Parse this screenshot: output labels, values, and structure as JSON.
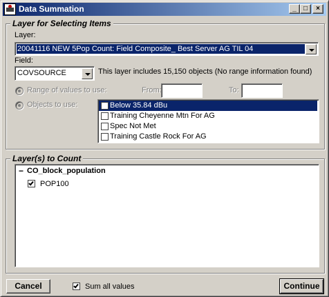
{
  "window": {
    "title": "Data Summation",
    "minimize_glyph": "_",
    "maximize_glyph": "□",
    "close_glyph": "×"
  },
  "selecting": {
    "group_label": "Layer for Selecting Items",
    "layer_label": "Layer:",
    "layer_value": "20041116 NEW 5Pop Count: Field Composite_ Best Server AG TIL 04",
    "field_label": "Field:",
    "field_value": "COVSOURCE",
    "info_text": "This layer includes 15,150 objects (No range information found)",
    "range_label": "Range of values to use:",
    "from_label": "From:",
    "to_label": "To:",
    "from_value": "",
    "to_value": "",
    "objects_label": "Objects to use:",
    "objects": [
      {
        "label": "Below 35.84 dBu",
        "checked": false,
        "selected": true
      },
      {
        "label": "Training Cheyenne Mtn For AG",
        "checked": false,
        "selected": false
      },
      {
        "label": "Spec Not Met",
        "checked": false,
        "selected": false
      },
      {
        "label": "Training Castle Rock For AG",
        "checked": false,
        "selected": false
      }
    ]
  },
  "counting": {
    "group_label": "Layer(s) to Count",
    "tree_collapse_glyph": "−",
    "layer_name": "CO_block_population",
    "fields": [
      {
        "label": "POP100",
        "checked": true
      }
    ]
  },
  "footer": {
    "cancel_label": "Cancel",
    "sum_all_label": "Sum all values",
    "sum_all_checked": true,
    "continue_label": "Continue"
  },
  "colors": {
    "title_start": "#0a246a",
    "title_end": "#a6caf0",
    "selection": "#0a246a",
    "face": "#d4d0c8"
  }
}
